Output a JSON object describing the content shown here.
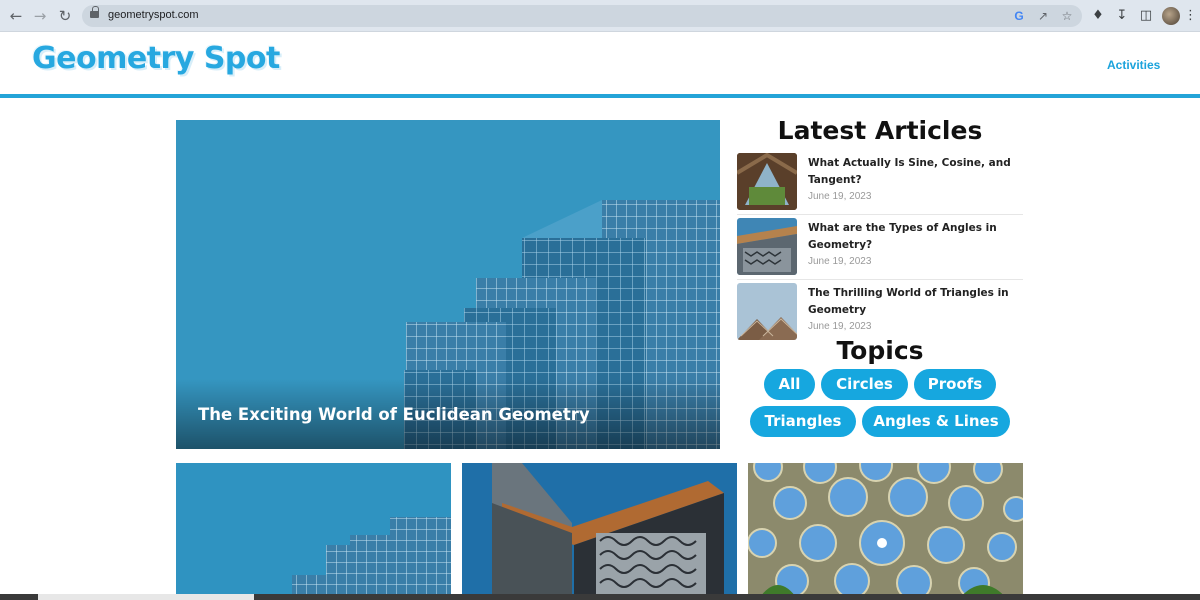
{
  "browser": {
    "url": "geometryspot.com",
    "icons": [
      "back-arrow-icon",
      "forward-arrow-icon",
      "reload-icon",
      "lock-icon",
      "google-icon",
      "share-icon",
      "star-icon",
      "extensions-icon",
      "download-icon",
      "side-panel-icon",
      "profile-avatar",
      "menu-dots-icon"
    ]
  },
  "header": {
    "logo_text": "Geometry Spot",
    "nav": {
      "activities": "Activities"
    },
    "accent_color": "#24a4d8"
  },
  "hero": {
    "title": "The Exciting World of Euclidean Geometry"
  },
  "latest": {
    "heading": "Latest Articles",
    "articles": [
      {
        "title": "What Actually Is Sine, Cosine, and Tangent?",
        "date": "June 19, 2023"
      },
      {
        "title": "What are the Types of Angles in Geometry?",
        "date": "June 19, 2023"
      },
      {
        "title": "The Thrilling World of Triangles in Geometry",
        "date": "June 19, 2023"
      }
    ]
  },
  "topics": {
    "heading": "Topics",
    "items": [
      "All",
      "Circles",
      "Proofs",
      "Triangles",
      "Angles & Lines"
    ],
    "pill_color": "#16a7df"
  }
}
